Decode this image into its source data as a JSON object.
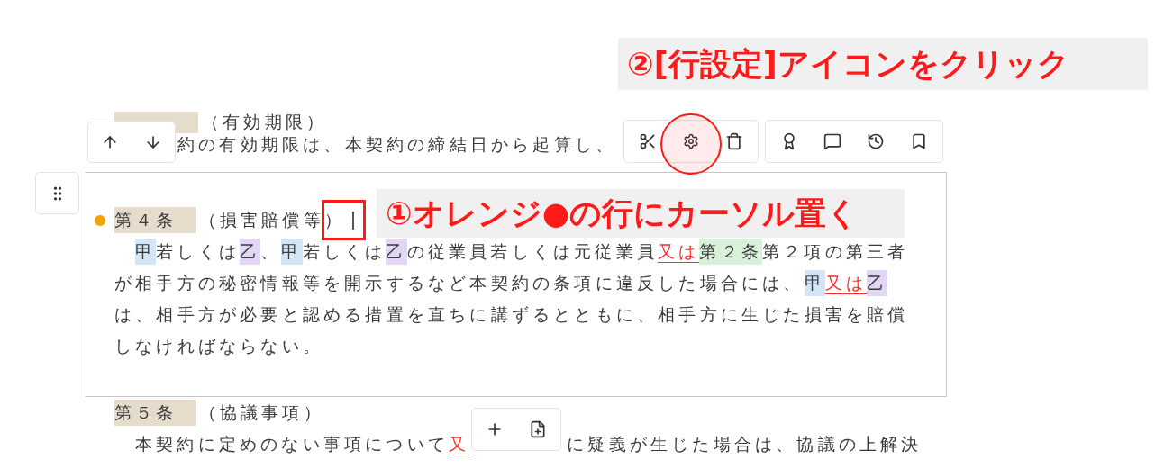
{
  "callouts": [
    {
      "text": "②[行設定]アイコンをクリック"
    },
    {
      "text": "①オレンジ●の行にカーソル置く"
    }
  ],
  "document": {
    "articles": [
      {
        "active": false,
        "title": "（有効期限）",
        "lines": [
          [
            {
              "kind": "plain",
              "text": "約の有効期限は、本契約の締結日から起算し、"
            }
          ]
        ]
      },
      {
        "active": true,
        "color": "#f5a300",
        "heading": "第４条",
        "title": "（損害賠償等）",
        "lines": [
          [
            {
              "kind": "party_a",
              "text": "甲"
            },
            {
              "kind": "plain",
              "text": "若しくは"
            },
            {
              "kind": "party_b",
              "text": "乙"
            },
            {
              "kind": "plain",
              "text": "、"
            },
            {
              "kind": "party_a",
              "text": "甲"
            },
            {
              "kind": "plain",
              "text": "若しくは"
            },
            {
              "kind": "party_b",
              "text": "乙"
            },
            {
              "kind": "plain",
              "text": "の従業員若しくは元従業員"
            },
            {
              "kind": "conjunction",
              "text": "又は"
            },
            {
              "kind": "reference",
              "text": "第２条"
            },
            {
              "kind": "plain",
              "text": "第２項の第三者"
            }
          ],
          [
            {
              "kind": "plain",
              "text": "が相手方の秘密情報等を開示するなど本契約の条項に違反した場合には、"
            },
            {
              "kind": "party_a",
              "text": "甲"
            },
            {
              "kind": "conjunction",
              "text": "又は"
            },
            {
              "kind": "party_b",
              "text": "乙"
            }
          ],
          [
            {
              "kind": "plain",
              "text": "は、相手方が必要と認める措置を直ちに講ずるとともに、相手方に生じた損害を賠償"
            }
          ],
          [
            {
              "kind": "plain",
              "text": "しなければならない。"
            }
          ]
        ]
      },
      {
        "active": false,
        "heading": "第５条",
        "title": "（協議事項）",
        "lines": [
          [
            {
              "kind": "plain",
              "text": "本契約に定めのない事項について"
            },
            {
              "kind": "conjunction",
              "text": "又"
            },
            {
              "kind": "gap"
            },
            {
              "kind": "plain",
              "text": "に疑義が生じた場合は、協議の上解決"
            }
          ]
        ]
      }
    ]
  }
}
